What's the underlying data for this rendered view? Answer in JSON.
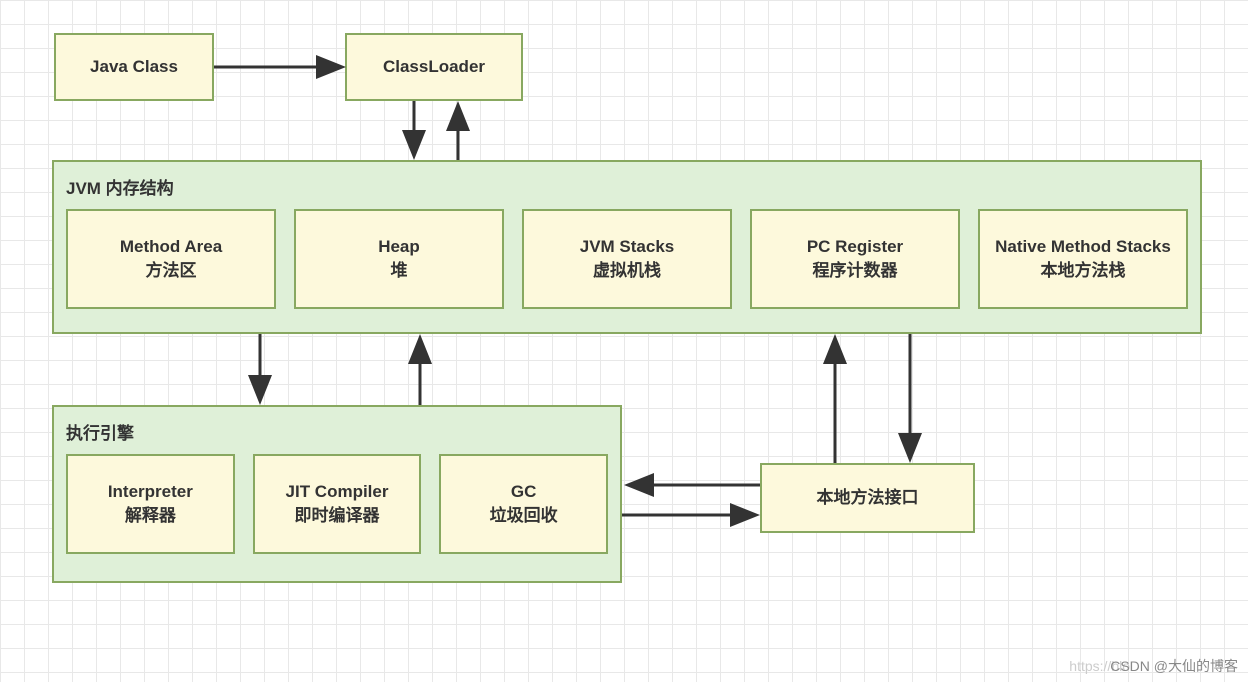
{
  "boxes": {
    "javaClass": "Java Class",
    "classLoader": "ClassLoader",
    "nativeInterface": "本地方法接口"
  },
  "memoryStructure": {
    "title": "JVM 内存结构",
    "items": [
      {
        "line1": "Method Area",
        "line2": "方法区"
      },
      {
        "line1": "Heap",
        "line2": "堆"
      },
      {
        "line1": "JVM Stacks",
        "line2": "虚拟机栈"
      },
      {
        "line1": "PC Register",
        "line2": "程序计数器"
      },
      {
        "line1": "Native Method Stacks",
        "line2": "本地方法栈"
      }
    ]
  },
  "executionEngine": {
    "title": "执行引擎",
    "items": [
      {
        "line1": "Interpreter",
        "line2": "解释器"
      },
      {
        "line1": "JIT Compiler",
        "line2": "即时编译器"
      },
      {
        "line1": "GC",
        "line2": "垃圾回收"
      }
    ]
  },
  "watermark": {
    "faint": "https://blo",
    "main": "CSDN @大仙的博客"
  }
}
